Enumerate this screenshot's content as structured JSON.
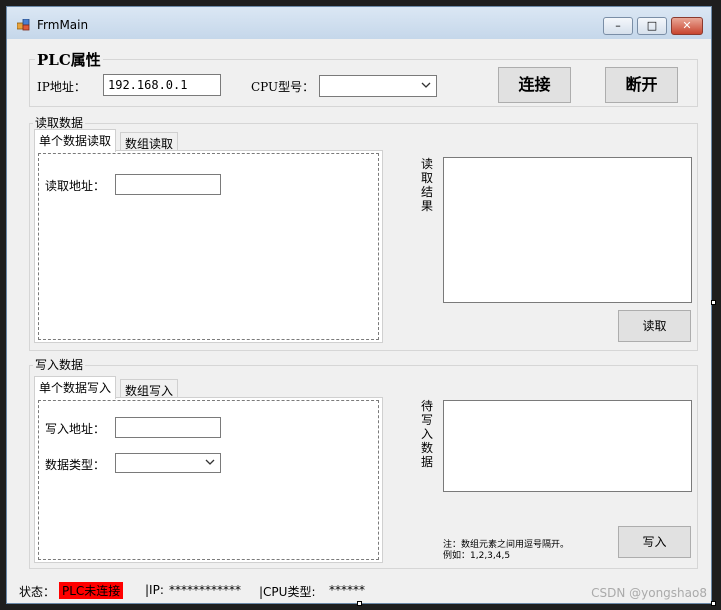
{
  "window": {
    "title": "FrmMain",
    "min": "–",
    "max": "□",
    "close": "✕"
  },
  "plc": {
    "group_title": "PLC属性",
    "ip_label": "IP地址：",
    "ip_value": "192.168.0.1",
    "cpu_label": "CPU型号：",
    "cpu_value": "",
    "connect_button": "连接",
    "disconnect_button": "断开"
  },
  "read": {
    "group_title": "读取数据",
    "tabs": [
      {
        "label": "单个数据读取"
      },
      {
        "label": "数组读取"
      }
    ],
    "address_label": "读取地址：",
    "address_value": "",
    "result_label": "读取结果",
    "result_value": "",
    "read_button": "读取"
  },
  "write": {
    "group_title": "写入数据",
    "tabs": [
      {
        "label": "单个数据写入"
      },
      {
        "label": "数组写入"
      }
    ],
    "address_label": "写入地址：",
    "address_value": "",
    "type_label": "数据类型：",
    "type_value": "",
    "pending_label": "待写入数据",
    "pending_value": "",
    "note_line1": "注：数组元素之间用逗号隔开。",
    "note_line2": "例如：1,2,3,4,5",
    "write_button": "写入"
  },
  "status_bar": {
    "status_label": "状态：",
    "status_value": "PLC未连接",
    "ip_label": "|IP:",
    "ip_value": "************",
    "cpu_label": "|CPU类型:",
    "cpu_value": "******",
    "status_color": "#ff0000"
  },
  "watermark": "CSDN @yongshao8"
}
